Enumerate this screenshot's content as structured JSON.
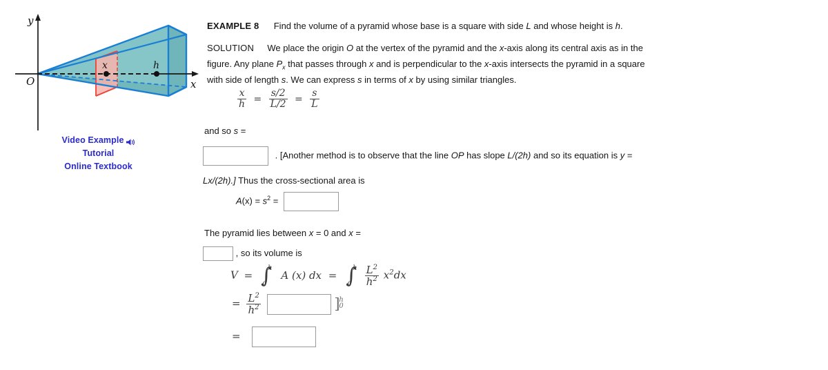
{
  "figure": {
    "axis_y_label": "y",
    "axis_x_label": "x",
    "origin_label": "O",
    "cross_section_label": "x",
    "height_label": "h",
    "colors": {
      "edge_blue": "#1a7fd4",
      "face_teal": "#7fc3c6",
      "face_teal_light": "#a8dbe0",
      "face_teal_dark": "#6fb5b9",
      "cross_section_red": "#ef4136",
      "cross_section_fill": "#f7b4ad",
      "axis_black": "#1a1a1a",
      "link_blue": "#2b2bc9"
    }
  },
  "links": [
    {
      "label": "Video Example",
      "icon": "speaker-icon"
    },
    {
      "label": "Tutorial",
      "icon": ""
    },
    {
      "label": "Online Textbook",
      "icon": ""
    }
  ],
  "example": {
    "tag": "EXAMPLE 8",
    "prompt_part1": "Find the volume of a pyramid whose base is a square with side ",
    "prompt_var1": "L",
    "prompt_part2": " and whose height is ",
    "prompt_var2": "h",
    "prompt_part3": "."
  },
  "solution": {
    "tag": "SOLUTION",
    "line1_a": "We place the origin ",
    "line1_O": "O",
    "line1_b": " at the vertex of the pyramid and the ",
    "line1_x": "x",
    "line1_c": "-axis along its central axis as in the",
    "line2_a": "figure. Any plane ",
    "line2_P": "P",
    "line2_Psub": "x",
    "line2_b": " that passes through ",
    "line2_x1": "x",
    "line2_c": " and is perpendicular to the ",
    "line2_x2": "x",
    "line2_d": "-axis intersects the pyramid in a square",
    "line3_a": "with side of length ",
    "line3_s1": "s",
    "line3_b": ". We can express ",
    "line3_s2": "s",
    "line3_c": " in terms of ",
    "line3_x": "x",
    "line3_d": " by using similar triangles."
  },
  "equation_similar": {
    "f1_num": "x",
    "f1_den": "h",
    "eq1": "=",
    "f2_num": "s/2",
    "f2_den": "L/2",
    "eq2": "=",
    "f3_num": "s",
    "f3_den": "L"
  },
  "and_so": {
    "text_a": "and so ",
    "var_s": "s",
    "text_b": " ="
  },
  "another_method": {
    "pre_punct": ". [Another method is to observe that the line ",
    "line_OP": "OP",
    "mid": " has slope ",
    "slope": "L/(2h)",
    "post": " and so its equation is ",
    "y_var": "y",
    "eq": " =",
    "next_line_a": "Lx/(2h).]",
    "next_line_b": " Thus the cross-sectional area is"
  },
  "area_line": {
    "prefix_A": "A",
    "paren_x": "(x)",
    "eq1": " = ",
    "s_var": "s",
    "s_exp": "2",
    "eq2": " ="
  },
  "bounds_line": {
    "text_a": "The pyramid lies between ",
    "x1": "x",
    "eq1": " = 0 and ",
    "x2": "x",
    "eq2": " =",
    "after_box": ", so its volume is"
  },
  "volume_eq": {
    "V": "V",
    "eq1": "=",
    "int1_lower": "0",
    "int1_upper": "h",
    "integrand1": "A (x) dx",
    "eq2": "=",
    "int2_lower": "0",
    "int2_upper": "h",
    "frac_num": "L",
    "frac_num_exp": "2",
    "frac_den": "h",
    "frac_den_exp": "2",
    "integrand2_var": "x",
    "integrand2_exp": "2",
    "integrand2_dx": "dx"
  },
  "volume_step2": {
    "eq": "=",
    "frac_num": "L",
    "frac_num_exp": "2",
    "frac_den": "h",
    "frac_den_exp": "2",
    "eval_upper": "h",
    "eval_lower": "0"
  },
  "volume_step3": {
    "eq": "="
  },
  "answer_boxes": {
    "box_s": "",
    "box_area": "",
    "box_bound": "",
    "box_step2": "",
    "box_step3": ""
  }
}
